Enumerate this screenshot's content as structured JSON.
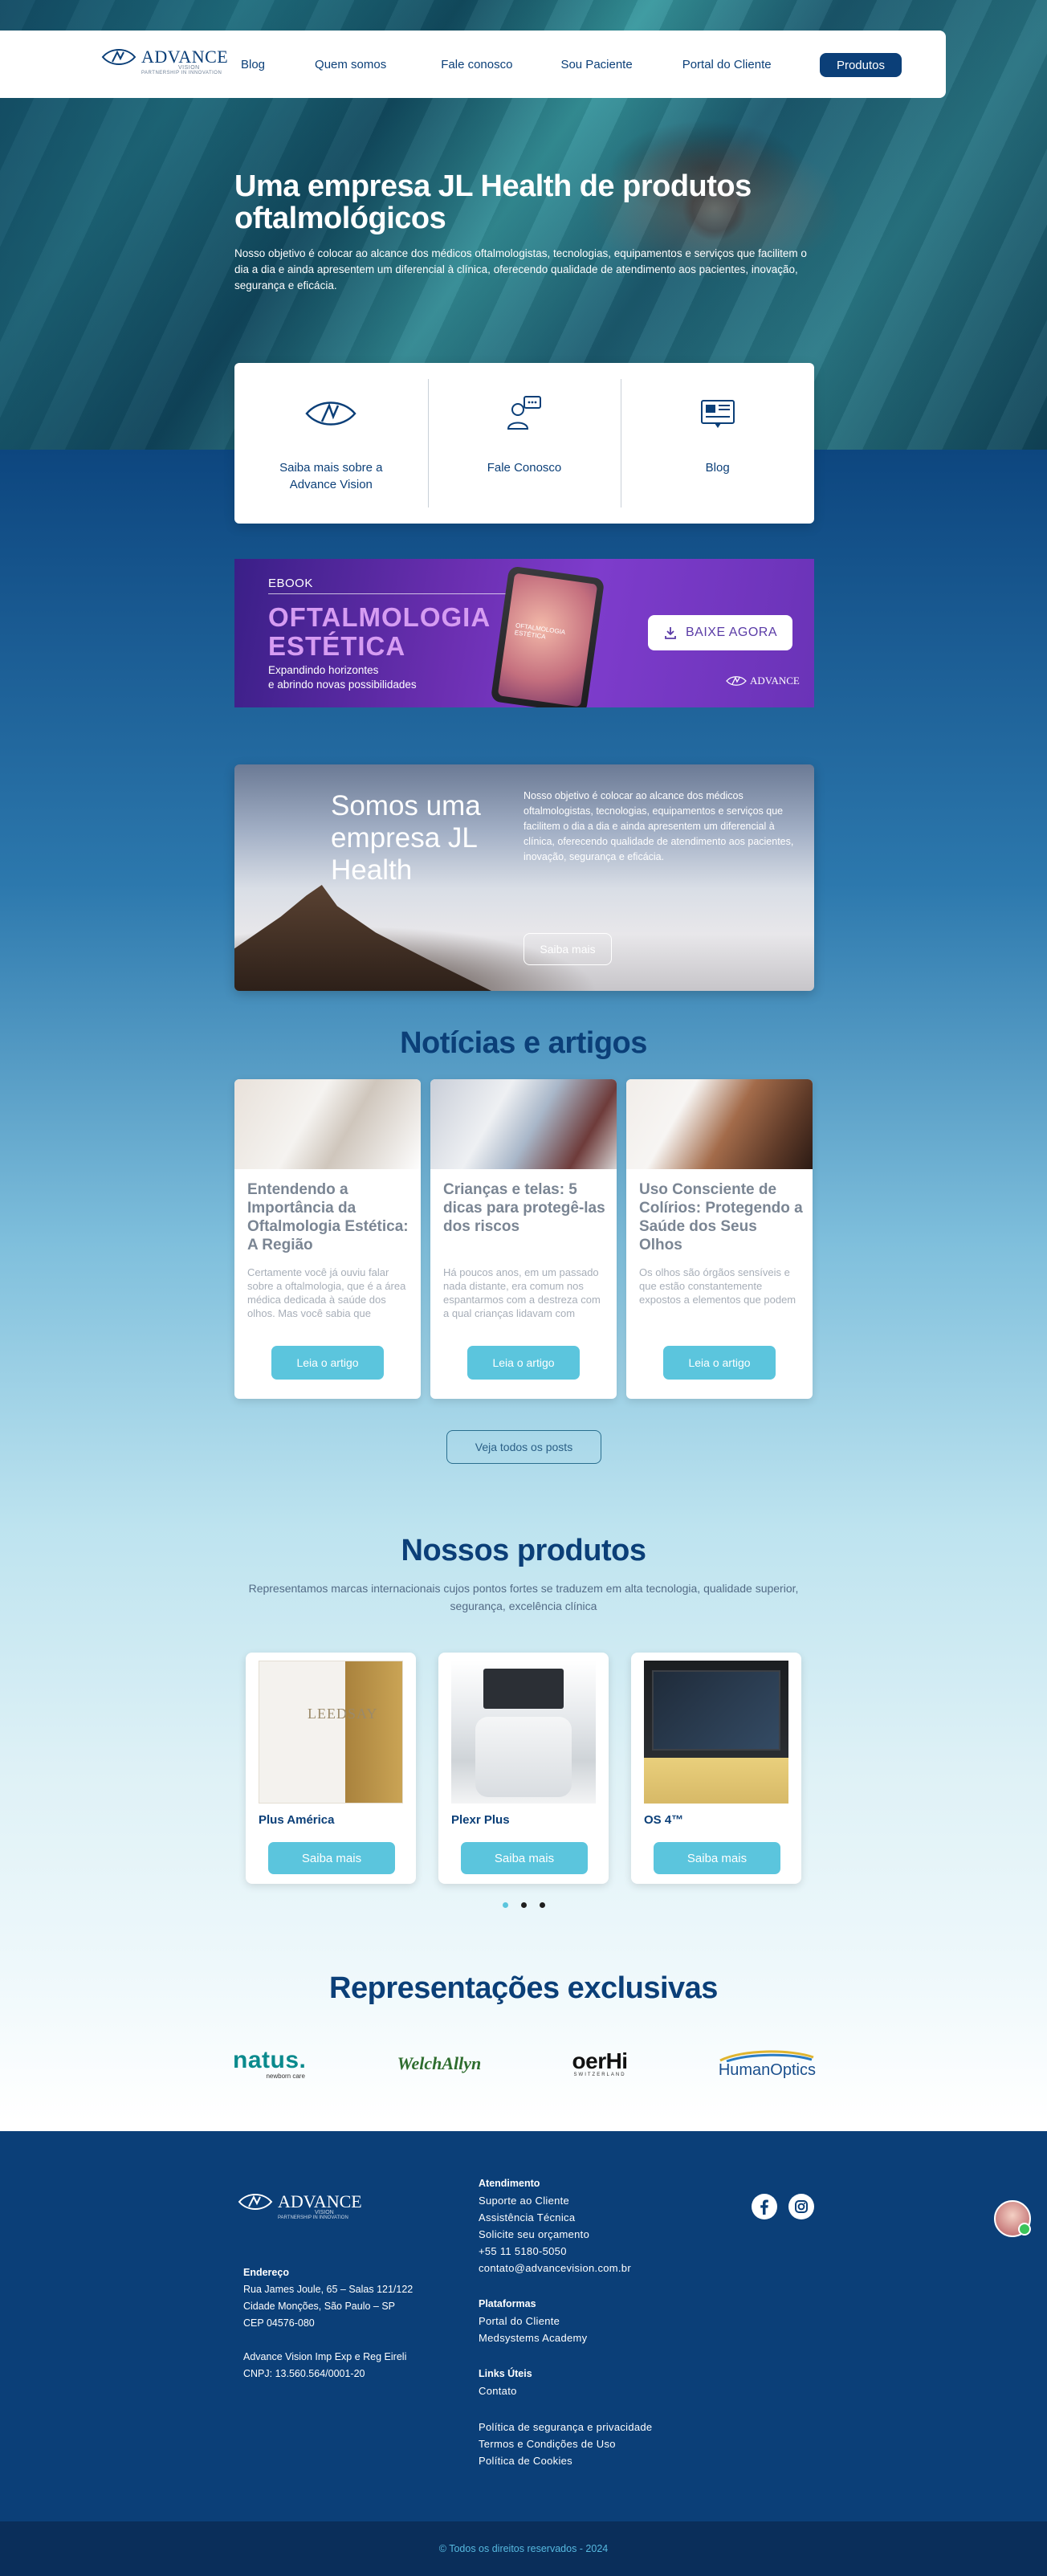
{
  "nav": {
    "logo_text": "ADVANCE",
    "logo_vision": "VISION",
    "logo_tagline": "PARTNERSHIP IN INNOVATION",
    "links": [
      "Blog",
      "Quem somos",
      "Fale conosco",
      "Sou Paciente",
      "Portal do Cliente"
    ],
    "cta": "Produtos"
  },
  "hero": {
    "title": "Uma empresa JL Health de produtos oftalmológicos",
    "description": "Nosso objetivo é colocar ao alcance dos médicos oftalmologistas, tecnologias, equipamentos e serviços que facilitem o dia a dia e ainda apresentem um diferencial à clínica, oferecendo qualidade de atendimento aos pacientes, inovação, segurança e eficácia."
  },
  "quick_links": [
    {
      "label": "Saiba mais sobre a Advance Vision",
      "icon": "eye-logo-icon"
    },
    {
      "label": "Fale Conosco",
      "icon": "contact-chat-icon"
    },
    {
      "label": "Blog",
      "icon": "blog-newspaper-icon"
    }
  ],
  "ebook": {
    "tag": "EBOOK",
    "title_line1": "OFTALMOLOGIA",
    "title_line2": "ESTÉTICA",
    "subtitle_line1": "Expandindo horizontes",
    "subtitle_line2": "e abrindo novas possibilidades",
    "tablet_text": "OFTALMOLOGIA ESTÉTICA",
    "button": "BAIXE AGORA",
    "logo_text": "ADVANCE"
  },
  "about": {
    "title": "Somos uma empresa JL Health",
    "text": "Nosso objetivo é colocar ao alcance dos médicos oftalmologistas, tecnologias, equipamentos e serviços que facilitem o dia a dia e ainda apresentem um diferencial à clínica, oferecendo qualidade de atendimento aos pacientes, inovação, segurança e eficácia.",
    "button": "Saiba mais"
  },
  "news": {
    "title": "Notícias e artigos",
    "cards": [
      {
        "title": "Entendendo a Importância da Oftalmologia Estética: A Região",
        "excerpt": "Certamente você já ouviu falar sobre a oftalmologia, que é a área médica dedicada à saúde dos olhos. Mas você sabia que",
        "button": "Leia o artigo"
      },
      {
        "title": "Crianças e telas: 5 dicas para protegê-las dos riscos",
        "excerpt": "Há poucos anos, em um passado nada distante, era comum nos espantarmos com a destreza com a qual crianças lidavam com",
        "button": "Leia o artigo"
      },
      {
        "title": "Uso Consciente de Colírios: Protegendo a Saúde dos Seus Olhos",
        "excerpt": "Os olhos são órgãos sensíveis e que estão constantemente expostos a elementos que podem",
        "button": "Leia o artigo"
      }
    ],
    "all_posts": "Veja todos os posts"
  },
  "products": {
    "title": "Nossos produtos",
    "subtitle": "Representamos marcas internacionais cujos pontos fortes se traduzem em alta tecnologia, qualidade superior, segurança, excelência clínica",
    "items": [
      {
        "name": "Plus América",
        "button": "Saiba mais",
        "box_label": "LEEDSAY"
      },
      {
        "name": "Plexr Plus",
        "button": "Saiba mais"
      },
      {
        "name": "OS 4™",
        "button": "Saiba mais"
      }
    ]
  },
  "representations": {
    "title": "Representações exclusivas",
    "brands": [
      {
        "name": "natus.",
        "tagline": "newborn care"
      },
      {
        "name": "WelchAllyn",
        "tagline": ""
      },
      {
        "name": "oerHi",
        "tagline": "SWITZERLAND"
      },
      {
        "name": "HumanOptics",
        "tagline": ""
      }
    ]
  },
  "footer": {
    "address_head": "Endereço",
    "address_lines": [
      "Rua James Joule, 65 – Salas 121/122",
      "Cidade Monções, São Paulo – SP",
      "CEP 04576-080"
    ],
    "company_lines": [
      "Advance Vision Imp Exp e Reg Eireli",
      "CNPJ: 13.560.564/0001-20"
    ],
    "atendimento_head": "Atendimento",
    "atendimento_links": [
      "Suporte ao Cliente",
      "Assistência Técnica",
      "Solicite seu orçamento",
      "+55 11 5180-5050",
      "contato@advancevision.com.br"
    ],
    "plataformas_head": "Plataformas",
    "plataformas_links": [
      "Portal do Cliente",
      "Medsystems Academy"
    ],
    "links_head": "Links Úteis",
    "links_links": [
      "Contato"
    ],
    "policies": [
      "Política de segurança e privacidade",
      "Termos e Condições de Uso",
      "Política de Cookies"
    ],
    "copyright": "© Todos os direitos reservados - 2024"
  },
  "colors": {
    "brand": "#0b3f78",
    "accent": "#5bc5dd",
    "ebook_purple": "#6b2fb1"
  }
}
